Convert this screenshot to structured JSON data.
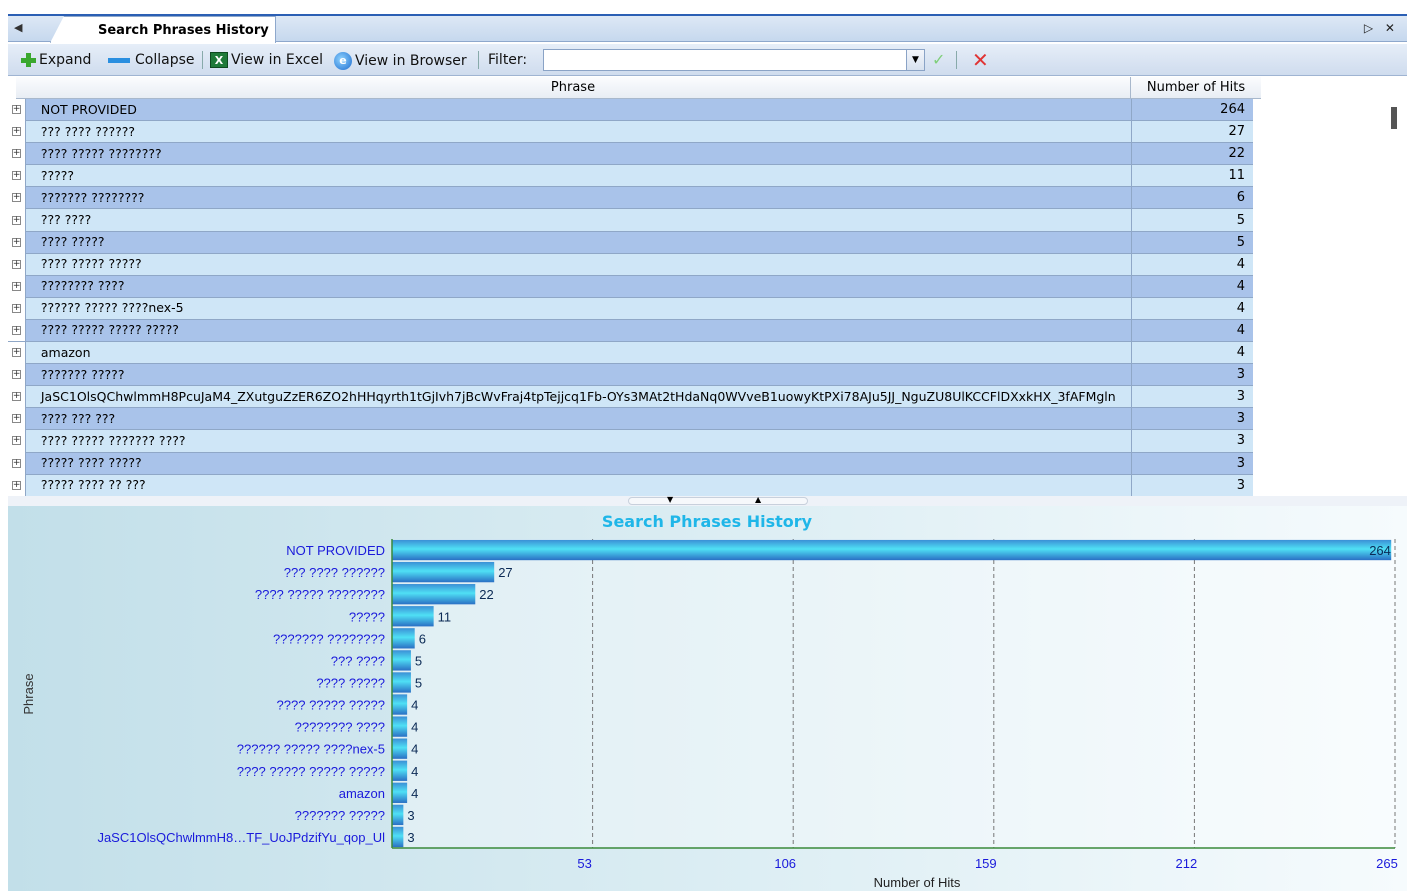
{
  "window": {
    "tab_title": "Search Phrases History",
    "left_arrow": "◀",
    "right_controls": "▷ ✕"
  },
  "toolbar": {
    "expand": "Expand",
    "collapse": "Collapse",
    "view_excel": "View in Excel",
    "view_browser": "View in Browser",
    "filter_label": "Filter:",
    "filter_value": ""
  },
  "grid": {
    "columns": [
      "Phrase",
      "Number of Hits"
    ],
    "rows": [
      {
        "phrase": "NOT PROVIDED",
        "hits": "264"
      },
      {
        "phrase": "??? ???? ??????",
        "hits": "27"
      },
      {
        "phrase": "???? ????? ????????",
        "hits": "22"
      },
      {
        "phrase": "?????",
        "hits": "11"
      },
      {
        "phrase": "??????? ????????",
        "hits": "6"
      },
      {
        "phrase": "??? ????",
        "hits": "5"
      },
      {
        "phrase": "???? ?????",
        "hits": "5"
      },
      {
        "phrase": "???? ????? ?????",
        "hits": "4"
      },
      {
        "phrase": "???????? ????",
        "hits": "4"
      },
      {
        "phrase": "?????? ????? ????nex-5",
        "hits": "4"
      },
      {
        "phrase": "???? ????? ????? ?????",
        "hits": "4"
      },
      {
        "phrase": "amazon",
        "hits": "4"
      },
      {
        "phrase": "??????? ?????",
        "hits": "3"
      },
      {
        "phrase": "JaSC1OlsQChwlmmH8PcuJaM4_ZXutguZzER6ZO2hHHqyrth1tGjIvh7jBcWvFraj4tpTejjcq1Fb-OYs3MAt2tHdaNq0WVveB1uowyKtPXi78AJu5JJ_NguZU8UlKCCFlDXxkHX_3fAFMgln",
        "hits": "3"
      },
      {
        "phrase": "???? ??? ???",
        "hits": "3"
      },
      {
        "phrase": "???? ????? ??????? ????",
        "hits": "3"
      },
      {
        "phrase": "????? ???? ?????",
        "hits": "3"
      },
      {
        "phrase": "????? ???? ?? ???",
        "hits": "3"
      }
    ]
  },
  "chart_data": {
    "type": "bar",
    "orientation": "horizontal",
    "title": "Search Phrases History",
    "xlabel": "Number of Hits",
    "ylabel": "Phrase",
    "xlim": [
      0,
      265
    ],
    "xticks": [
      "53",
      "106",
      "159",
      "212",
      "265"
    ],
    "categories": [
      "NOT PROVIDED",
      "??? ???? ??????",
      "???? ????? ????????",
      "?????",
      "??????? ????????",
      "??? ????",
      "???? ?????",
      "???? ????? ?????",
      "???????? ????",
      "?????? ????? ????nex-5",
      "???? ????? ????? ?????",
      "amazon",
      "??????? ?????",
      "JaSC1OlsQChwlmmH8…TF_UoJPdzifYu_qop_Ul"
    ],
    "values": [
      264,
      27,
      22,
      11,
      6,
      5,
      5,
      4,
      4,
      4,
      4,
      4,
      3,
      3
    ],
    "grid": true,
    "colors": {
      "title": "#1fb6e8",
      "label": "#1a1adb",
      "bar": "#2cc8ef",
      "axis": "#3a8a3a"
    }
  }
}
